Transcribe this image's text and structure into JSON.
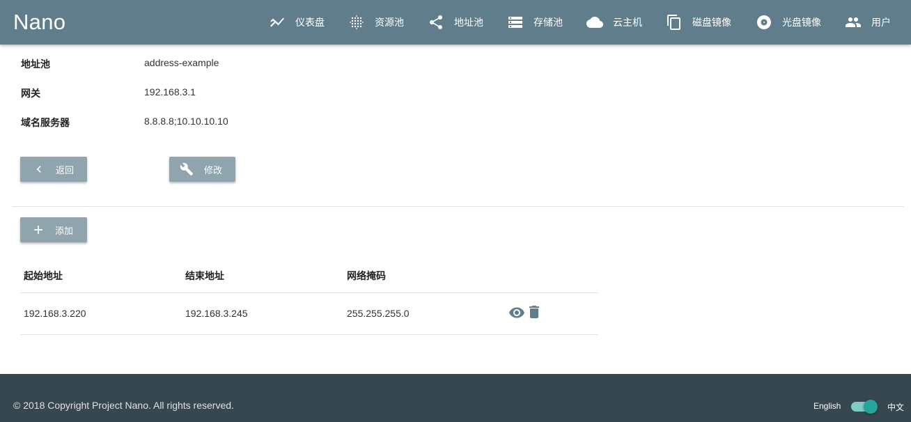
{
  "app": {
    "brand": "Nano"
  },
  "nav": {
    "dashboard": "仪表盘",
    "resource_pool": "资源池",
    "address_pool": "地址池",
    "storage_pool": "存储池",
    "cloud_instance": "云主机",
    "disk_image": "磁盘镜像",
    "iso_image": "光盘镜像",
    "user": "用户"
  },
  "details": {
    "pool_label": "地址池",
    "pool_value": "address-example",
    "gateway_label": "网关",
    "gateway_value": "192.168.3.1",
    "dns_label": "域名服务器",
    "dns_value": "8.8.8.8;10.10.10.10"
  },
  "actions": {
    "back_label": "返回",
    "modify_label": "修改",
    "add_label": "添加"
  },
  "table": {
    "headers": [
      "起始地址",
      "结束地址",
      "网络掩码"
    ],
    "rows": [
      {
        "start": "192.168.3.220",
        "end": "192.168.3.245",
        "netmask": "255.255.255.0"
      }
    ]
  },
  "footer": {
    "copyright": "© 2018 Copyright Project Nano. All rights reserved.",
    "lang_en": "English",
    "lang_zh": "中文",
    "lang_switch_on": true
  },
  "colors": {
    "appbar": "#607d8b",
    "button": "#90a4ae",
    "footer": "#37474f",
    "switch_accent": "#26a69a",
    "icon": "#607d8b"
  },
  "icons": {
    "dashboard": "trending-icon",
    "resource_pool": "grain-icon",
    "address_pool": "share-icon",
    "storage_pool": "storage-icon",
    "cloud_instance": "cloud-icon",
    "disk_image": "copy-icon",
    "iso_image": "disc-icon",
    "user": "people-icon",
    "back": "chevron-left-icon",
    "modify": "wrench-icon",
    "add": "plus-icon",
    "view": "eye-icon",
    "delete": "trash-icon"
  }
}
